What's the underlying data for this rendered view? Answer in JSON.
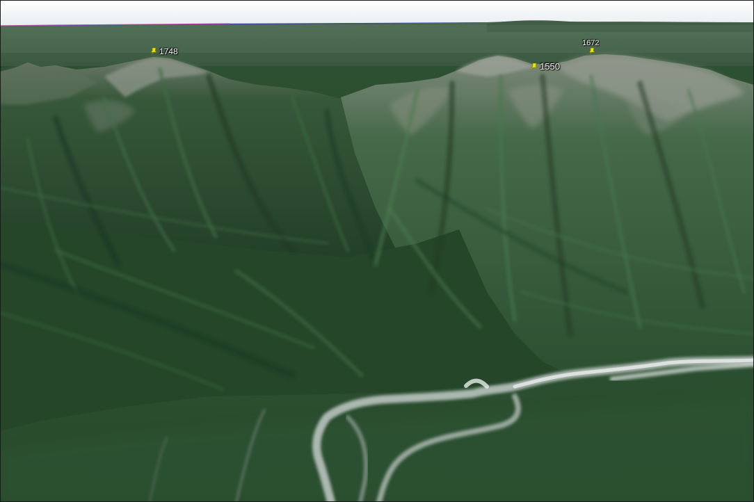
{
  "map": {
    "view": "3d-terrain",
    "imagery": "satellite",
    "colors": {
      "sky": "#f1f4f6",
      "horizon_haze": "#3f5d44",
      "forest_dark": "#1e3a23",
      "forest_mid": "#35603a",
      "ridge_rock": "#8c9489",
      "river_bed": "#c9d1cf"
    }
  },
  "placemarks": [
    {
      "label": "1748",
      "icon": "yellow-pushpin-icon",
      "color": "#f2e600"
    },
    {
      "label": "1550",
      "icon": "yellow-pushpin-icon",
      "color": "#f2e600"
    },
    {
      "label": "1672",
      "icon": "yellow-pushpin-icon",
      "color": "#f2e600"
    }
  ]
}
